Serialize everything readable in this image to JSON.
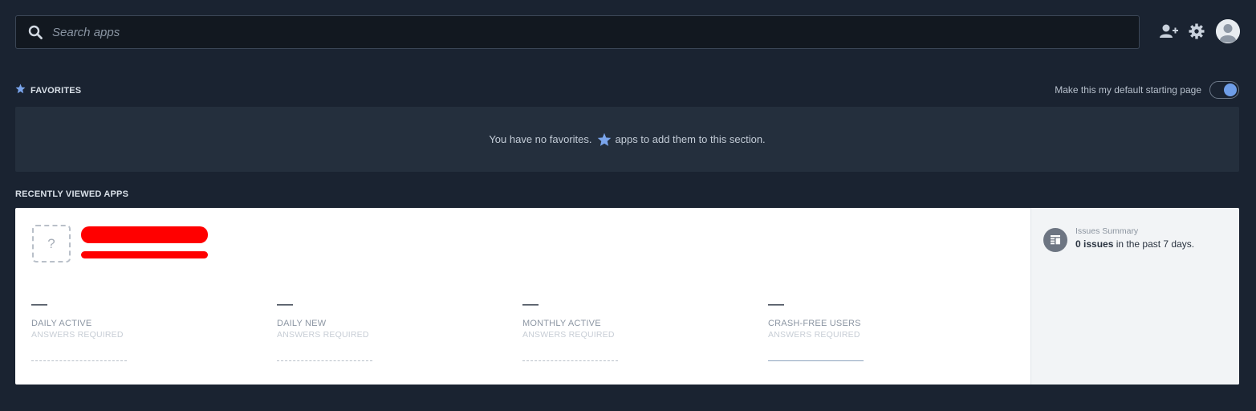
{
  "search": {
    "placeholder": "Search apps",
    "icon": "search-icon"
  },
  "header_icons": [
    "add-user-icon",
    "gear-icon",
    "avatar"
  ],
  "favorites": {
    "title": "FAVORITES",
    "icon": "star-icon",
    "default_page_label": "Make this my default starting page",
    "default_page_toggle_on": true,
    "empty_text_before": "You have no favorites.",
    "empty_text_after": "apps to add them to this section."
  },
  "recent": {
    "title": "RECENTLY VIEWED APPS",
    "app": {
      "icon_placeholder": "?",
      "metrics": [
        {
          "value": "—",
          "label": "DAILY ACTIVE",
          "sub": "ANSWERS REQUIRED"
        },
        {
          "value": "—",
          "label": "DAILY NEW",
          "sub": "ANSWERS REQUIRED"
        },
        {
          "value": "—",
          "label": "MONTHLY ACTIVE",
          "sub": "ANSWERS REQUIRED"
        },
        {
          "value": "—",
          "label": "CRASH-FREE USERS",
          "sub": "ANSWERS REQUIRED"
        }
      ],
      "issues": {
        "title": "Issues Summary",
        "count_text": "0 issues",
        "rest_text": " in the past 7 days."
      }
    }
  },
  "colors": {
    "background": "#1a2331",
    "panel": "#242f3d",
    "accent": "#6f9ee8",
    "redaction": "#ff0000"
  }
}
